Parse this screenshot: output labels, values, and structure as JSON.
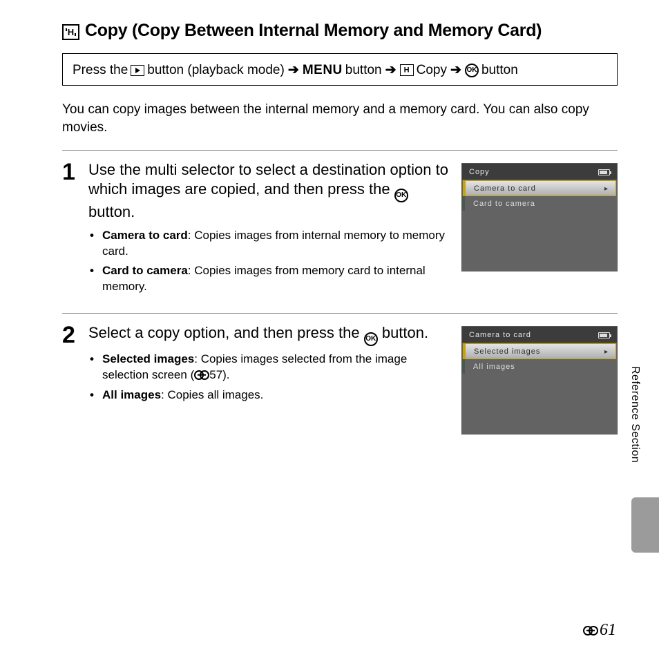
{
  "heading": {
    "title": "Copy (Copy Between Internal Memory and Memory Card)"
  },
  "nav": {
    "a": "Press the",
    "b": "button (playback mode)",
    "menu": "MENU",
    "c": "button",
    "d": "Copy",
    "e": "button"
  },
  "intro": "You can copy images between the internal memory and a memory card. You can also copy movies.",
  "steps": [
    {
      "num": "1",
      "title_a": "Use the multi selector to select a destination option to which images are copied, and then press the ",
      "title_b": " button.",
      "bullets": [
        {
          "label": "Camera to card",
          "text": ": Copies images from internal memory to memory card."
        },
        {
          "label": "Card to camera",
          "text": ": Copies images from memory card to internal memory."
        }
      ],
      "screen": {
        "title": "Copy",
        "items": [
          {
            "label": "Camera to card",
            "selected": true
          },
          {
            "label": "Card to camera",
            "selected": false
          }
        ]
      }
    },
    {
      "num": "2",
      "title_a": "Select a copy option, and then press the ",
      "title_b": " button.",
      "bullets": [
        {
          "label": "Selected images",
          "text": ": Copies images selected from the image selection screen (",
          "ref": "57).",
          "has_ref": true
        },
        {
          "label": "All images",
          "text": ": Copies all images."
        }
      ],
      "screen": {
        "title": "Camera to card",
        "items": [
          {
            "label": "Selected images",
            "selected": true
          },
          {
            "label": "All images",
            "selected": false
          }
        ]
      }
    }
  ],
  "side": "Reference Section",
  "page": "61"
}
